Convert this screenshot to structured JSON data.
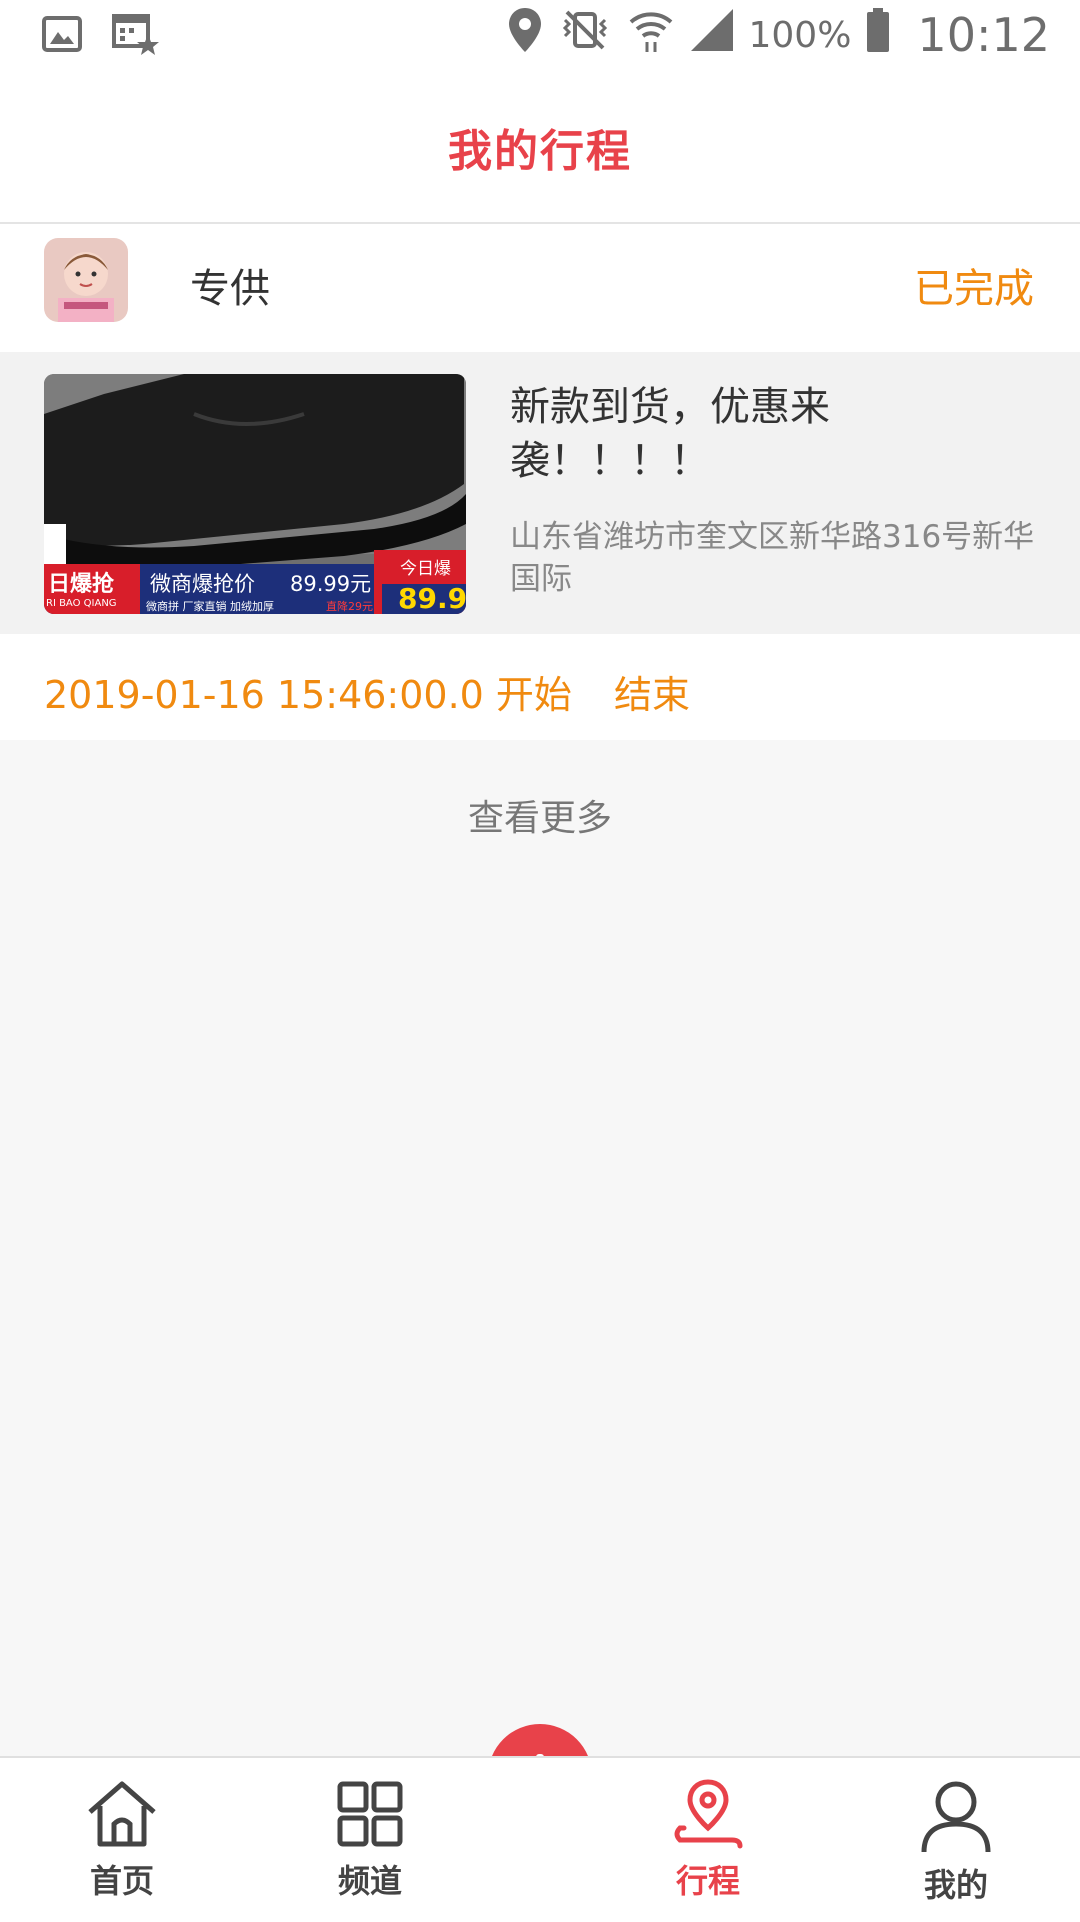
{
  "status_bar": {
    "battery": "100%",
    "time": "10:12",
    "icons": [
      "image-icon",
      "calendar-star-icon",
      "location-icon",
      "vibrate-icon",
      "wifi-icon",
      "signal-icon",
      "battery-icon"
    ]
  },
  "header": {
    "title": "我的行程"
  },
  "trip": {
    "shop_name": "专供",
    "status": "已完成",
    "promo_title": "新款到货，优惠来袭！！！！",
    "address": "山东省潍坊市奎文区新华路316号新华国际",
    "start_time": "2019-01-16 15:46:00.0 开始",
    "end_label": "结束",
    "banner": {
      "left_tag": "日爆抢",
      "left_sub": "RI BAO QIANG",
      "center": "微商爆抢价",
      "center_price": "89.99元",
      "center_sub": "微商拼  厂家直销  加绒加厚",
      "center_tag": "直降29元",
      "right_tag": "今日爆",
      "right_price": "89.9"
    }
  },
  "more_label": "查看更多",
  "nav": {
    "home": "首页",
    "channel": "频道",
    "trip": "行程",
    "mine": "我的"
  },
  "colors": {
    "accent": "#e8424a",
    "orange": "#f08a10"
  }
}
